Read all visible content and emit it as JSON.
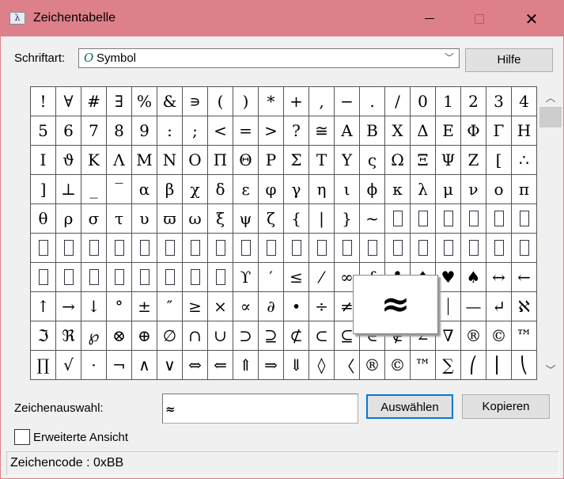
{
  "window": {
    "title": "Zeichentabelle",
    "minimize": "minimize",
    "maximize": "maximize",
    "close": "✕"
  },
  "font": {
    "label": "Schriftart:",
    "value": "Symbol",
    "icon": "O",
    "help_button": "Hilfe"
  },
  "grid": {
    "rows": [
      [
        "!",
        "∀",
        "#",
        "∃",
        "%",
        "&",
        "∍",
        "(",
        ")",
        "*",
        "+",
        ",",
        "−",
        ".",
        "/",
        "0",
        "1",
        "2",
        "3",
        "4"
      ],
      [
        "5",
        "6",
        "7",
        "8",
        "9",
        ":",
        ";",
        "<",
        "=",
        ">",
        "?",
        "≅",
        "Α",
        "Β",
        "Χ",
        "Δ",
        "Ε",
        "Φ",
        "Γ",
        "Η"
      ],
      [
        "Ι",
        "ϑ",
        "Κ",
        "Λ",
        "Μ",
        "Ν",
        "Ο",
        "Π",
        "Θ",
        "Ρ",
        "Σ",
        "Τ",
        "Υ",
        "ς",
        "Ω",
        "Ξ",
        "Ψ",
        "Ζ",
        "[",
        "∴"
      ],
      [
        "]",
        "⊥",
        "_",
        "‾",
        "α",
        "β",
        "χ",
        "δ",
        "ε",
        "φ",
        "γ",
        "η",
        "ι",
        "ϕ",
        "κ",
        "λ",
        "μ",
        "ν",
        "ο",
        "π"
      ],
      [
        "θ",
        "ρ",
        "σ",
        "τ",
        "υ",
        "ϖ",
        "ω",
        "ξ",
        "ψ",
        "ζ",
        "{",
        "|",
        "}",
        "~",
        "□",
        "□",
        "□",
        "□",
        "□",
        "□"
      ],
      [
        "□",
        "□",
        "□",
        "□",
        "□",
        "□",
        "□",
        "□",
        "□",
        "□",
        "□",
        "□",
        "□",
        "□",
        "□",
        "□",
        "□",
        "□",
        "□",
        "□"
      ],
      [
        "□",
        "□",
        "□",
        "□",
        "□",
        "□",
        "□",
        "□",
        "ϒ",
        "′",
        "≤",
        "⁄",
        "∞",
        "ƒ",
        "♣",
        "♦",
        "♥",
        "♠",
        "↔",
        "←"
      ],
      [
        "↑",
        "→",
        "↓",
        "°",
        "±",
        "″",
        "≥",
        "×",
        "∝",
        "∂",
        "•",
        "÷",
        "≠",
        "≡",
        "≈",
        "…",
        "⏐",
        "—",
        "↵",
        "ℵ"
      ],
      [
        "ℑ",
        "ℜ",
        "℘",
        "⊗",
        "⊕",
        "∅",
        "∩",
        "∪",
        "⊃",
        "⊇",
        "⊄",
        "⊂",
        "⊆",
        "∈",
        "∉",
        "∠",
        "∇",
        "®",
        "©",
        "™"
      ],
      [
        "∏",
        "√",
        "·",
        "¬",
        "∧",
        "∨",
        "⇔",
        "⇐",
        "⇑",
        "⇒",
        "⇓",
        "◊",
        "〈",
        "®",
        "©",
        "™",
        "∑",
        "⎛",
        "⎜",
        "⎝"
      ]
    ],
    "selected_char": "≈",
    "selected_row": 7,
    "selected_col": 14
  },
  "selection": {
    "label": "Zeichenauswahl:",
    "value": "≈",
    "select_button": "Auswählen",
    "copy_button": "Kopieren"
  },
  "advanced": {
    "label": "Erweiterte Ansicht",
    "checked": false
  },
  "status": {
    "text": "Zeichencode : 0xBB"
  },
  "colors": {
    "titlebar": "#de808a",
    "focus": "#0078d7"
  }
}
